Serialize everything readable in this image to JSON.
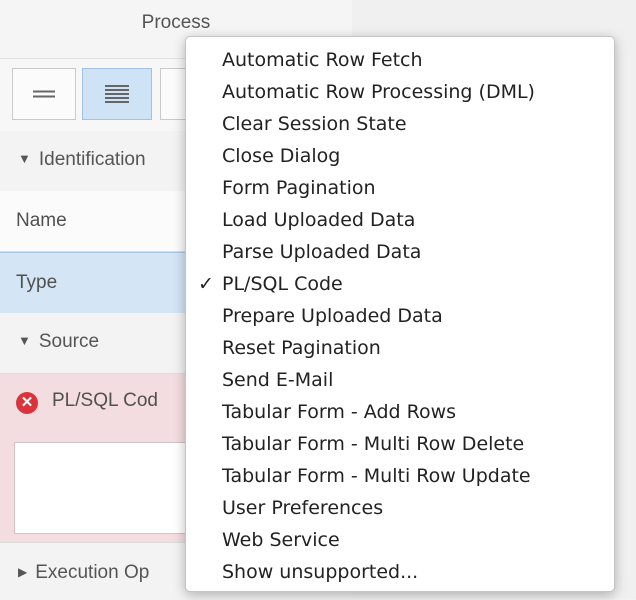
{
  "panel": {
    "title": "Process",
    "sections": {
      "identification": "Identification",
      "source": "Source",
      "execution": "Execution Op"
    },
    "fields": {
      "name_label": "Name",
      "type_label": "Type",
      "plsql_label": "PL/SQL Cod"
    }
  },
  "icons": {
    "triangle_down": "▼",
    "triangle_right": "▶",
    "error": "✕",
    "check": "✓"
  },
  "menu": {
    "items": [
      {
        "label": "Automatic Row Fetch",
        "checked": false
      },
      {
        "label": "Automatic Row Processing (DML)",
        "checked": false
      },
      {
        "label": "Clear Session State",
        "checked": false
      },
      {
        "label": "Close Dialog",
        "checked": false
      },
      {
        "label": "Form Pagination",
        "checked": false
      },
      {
        "label": "Load Uploaded Data",
        "checked": false
      },
      {
        "label": "Parse Uploaded Data",
        "checked": false
      },
      {
        "label": "PL/SQL Code",
        "checked": true
      },
      {
        "label": "Prepare Uploaded Data",
        "checked": false
      },
      {
        "label": "Reset Pagination",
        "checked": false
      },
      {
        "label": "Send E-Mail",
        "checked": false
      },
      {
        "label": "Tabular Form - Add Rows",
        "checked": false
      },
      {
        "label": "Tabular Form - Multi Row Delete",
        "checked": false
      },
      {
        "label": "Tabular Form - Multi Row Update",
        "checked": false
      },
      {
        "label": "User Preferences",
        "checked": false
      },
      {
        "label": "Web Service",
        "checked": false
      },
      {
        "label": "Show unsupported...",
        "checked": false
      }
    ]
  }
}
